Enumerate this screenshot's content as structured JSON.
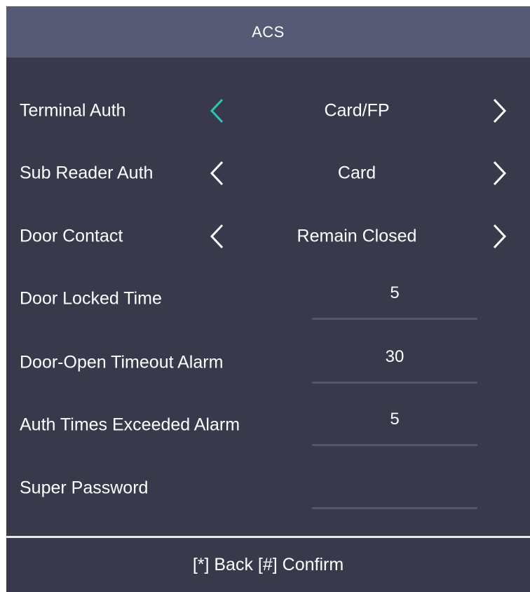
{
  "header": {
    "title": "ACS"
  },
  "colors": {
    "background": "#383a4c",
    "header": "#565a74",
    "focus_arrow": "#2ec4b6",
    "arrow": "#ffffff",
    "underline": "#54576a"
  },
  "selectors": [
    {
      "label": "Terminal Auth",
      "value": "Card/FP",
      "focused": true
    },
    {
      "label": "Sub Reader Auth",
      "value": "Card",
      "focused": false
    },
    {
      "label": "Door Contact",
      "value": "Remain Closed",
      "focused": false
    }
  ],
  "fields": [
    {
      "label": "Door Locked Time",
      "value": "5"
    },
    {
      "label": "Door-Open Timeout Alarm",
      "value": "30"
    },
    {
      "label": "Auth Times Exceeded Alarm",
      "value": "5"
    },
    {
      "label": "Super Password",
      "value": ""
    }
  ],
  "footer": {
    "hint": "[*] Back [#] Confirm"
  }
}
